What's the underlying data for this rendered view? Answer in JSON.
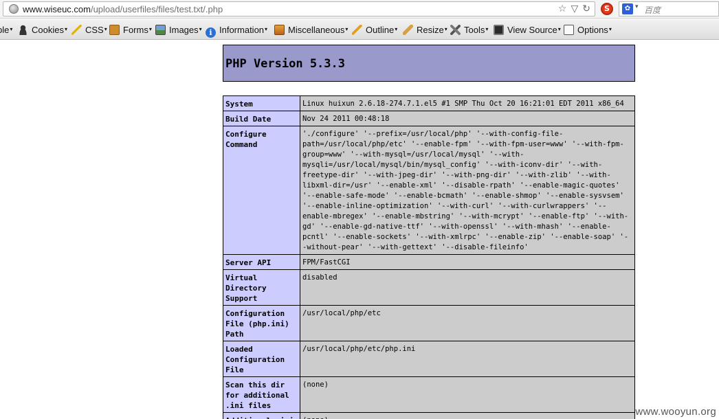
{
  "browser": {
    "url_domain": "www.wiseuc.com",
    "url_path": "/upload/userfiles/files/test.txt/.php",
    "search_placeholder": "百度",
    "search_engine_icon": "baidu-paw-icon",
    "noscript_icon": "noscript-block-icon"
  },
  "devtoolbar": {
    "items": [
      {
        "label": "ble",
        "icon": "none"
      },
      {
        "label": "Cookies",
        "icon": "person-icon"
      },
      {
        "label": "CSS",
        "icon": "magic-wand-icon"
      },
      {
        "label": "Forms",
        "icon": "clipboard-icon"
      },
      {
        "label": "Images",
        "icon": "picture-icon"
      },
      {
        "label": "Information",
        "icon": "info-icon"
      },
      {
        "label": "Miscellaneous",
        "icon": "box-icon"
      },
      {
        "label": "Outline",
        "icon": "pencil-icon"
      },
      {
        "label": "Resize",
        "icon": "ruler-icon"
      },
      {
        "label": "Tools",
        "icon": "wrench-icon"
      },
      {
        "label": "View Source",
        "icon": "monitor-icon"
      },
      {
        "label": "Options",
        "icon": "document-icon"
      }
    ]
  },
  "phpinfo": {
    "title": "PHP Version 5.3.3",
    "rows": [
      {
        "key": "System",
        "value": "Linux huixun 2.6.18-274.7.1.el5 #1 SMP Thu Oct 20 16:21:01 EDT 2011 x86_64"
      },
      {
        "key": "Build Date",
        "value": "Nov 24 2011 00:48:18"
      },
      {
        "key": "Configure Command",
        "value": "'./configure' '--prefix=/usr/local/php' '--with-config-file-path=/usr/local/php/etc' '--enable-fpm' '--with-fpm-user=www' '--with-fpm-group=www' '--with-mysql=/usr/local/mysql' '--with-mysqli=/usr/local/mysql/bin/mysql_config' '--with-iconv-dir' '--with-freetype-dir' '--with-jpeg-dir' '--with-png-dir' '--with-zlib' '--with-libxml-dir=/usr' '--enable-xml' '--disable-rpath' '--enable-magic-quotes' '--enable-safe-mode' '--enable-bcmath' '--enable-shmop' '--enable-sysvsem' '--enable-inline-optimization' '--with-curl' '--with-curlwrappers' '--enable-mbregex' '--enable-mbstring' '--with-mcrypt' '--enable-ftp' '--with-gd' '--enable-gd-native-ttf' '--with-openssl' '--with-mhash' '--enable-pcntl' '--enable-sockets' '--with-xmlrpc' '--enable-zip' '--enable-soap' '--without-pear' '--with-gettext' '--disable-fileinfo'"
      },
      {
        "key": "Server API",
        "value": "FPM/FastCGI"
      },
      {
        "key": "Virtual Directory Support",
        "value": "disabled"
      },
      {
        "key": "Configuration File (php.ini) Path",
        "value": "/usr/local/php/etc"
      },
      {
        "key": "Loaded Configuration File",
        "value": "/usr/local/php/etc/php.ini"
      },
      {
        "key": "Scan this dir for additional .ini files",
        "value": "(none)"
      },
      {
        "key": "Additional .ini files parsed",
        "value": "(none)"
      }
    ]
  },
  "watermark": "www.wooyun.org",
  "colors": {
    "header_bg": "#9999cc",
    "key_bg": "#ccccff",
    "value_bg": "#cccccc"
  }
}
